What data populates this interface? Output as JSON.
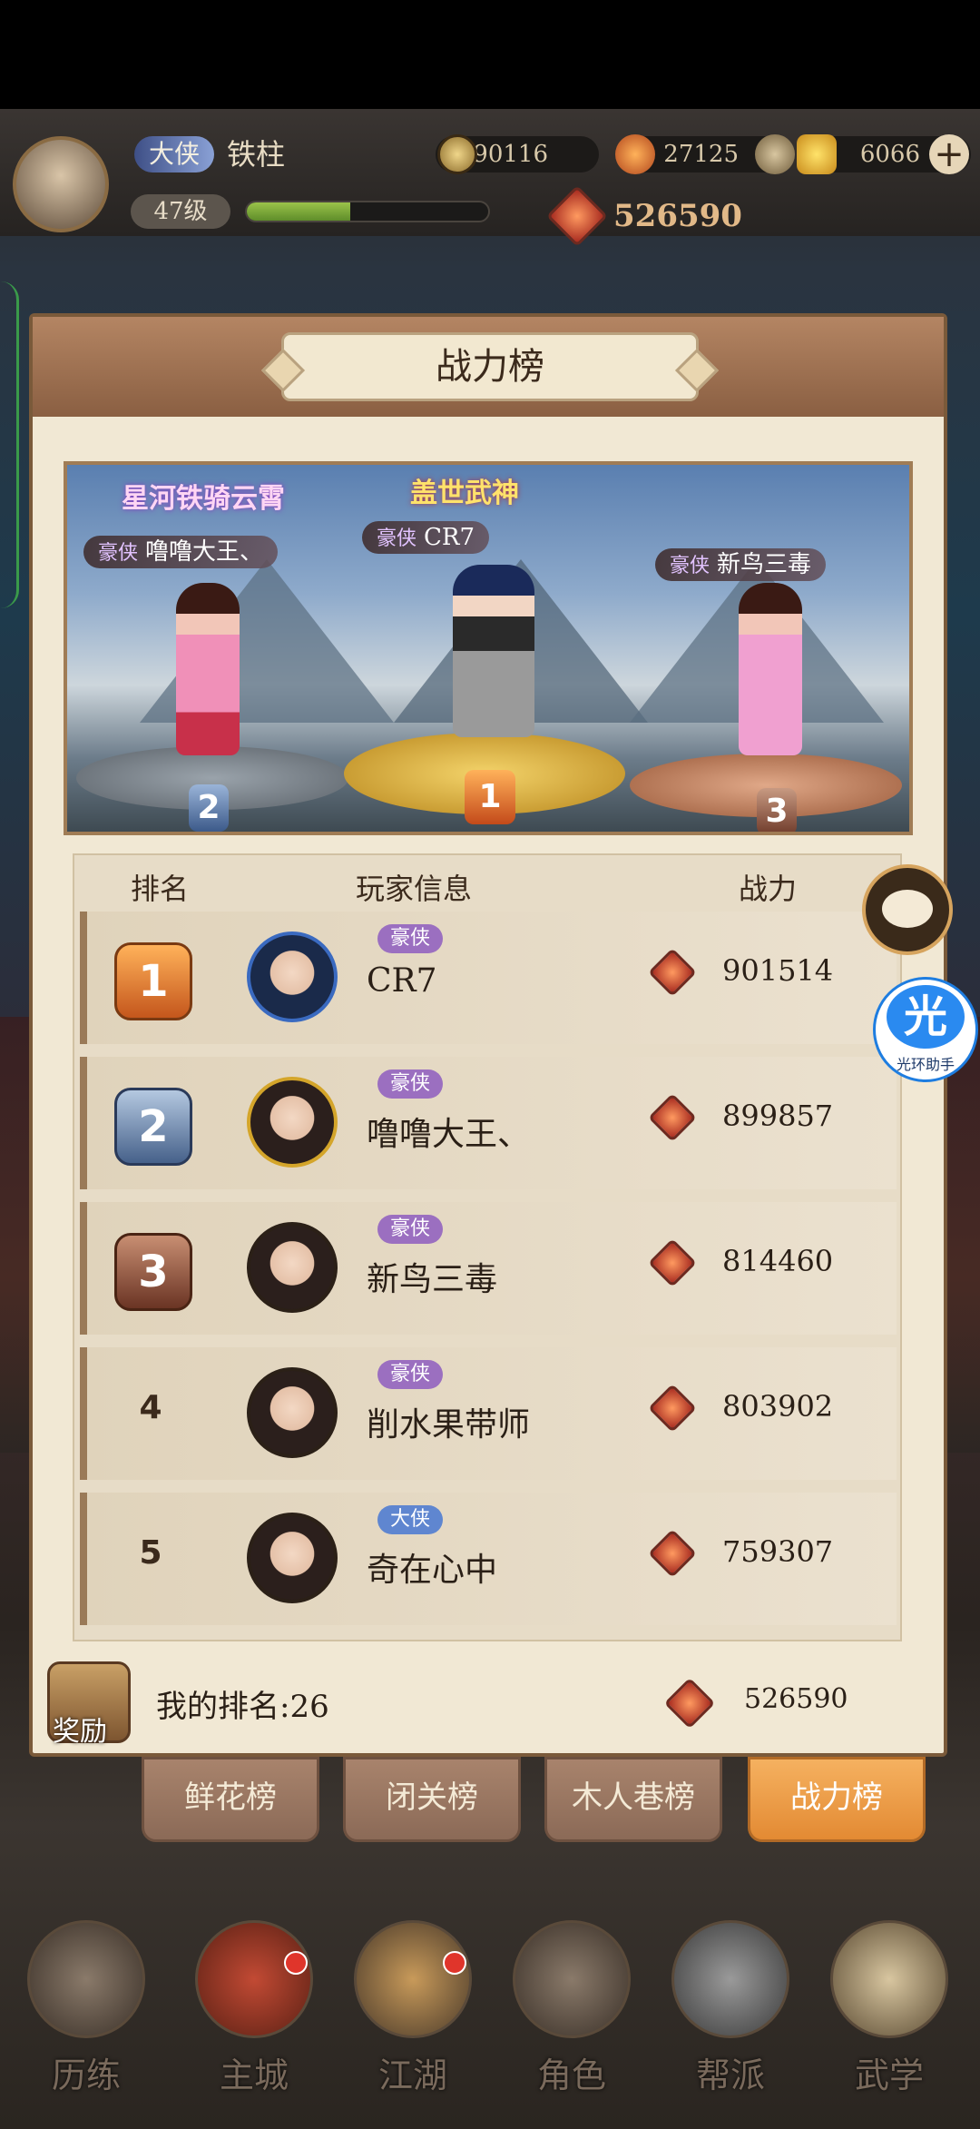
{
  "header": {
    "title_badge": "大侠",
    "player_name": "铁柱",
    "level": "47级",
    "xp_fraction": 0.43,
    "coins": "390116",
    "copper": "27125",
    "gold": "6066",
    "power": "526590"
  },
  "panel": {
    "title": "战力榜"
  },
  "podium": {
    "first": {
      "banner": "盖世武神",
      "tag": "豪侠",
      "name": "CR7",
      "rank": "1"
    },
    "second": {
      "banner": "星河铁骑云霄",
      "tag": "豪侠",
      "name": "噜噜大王、",
      "rank": "2"
    },
    "third": {
      "tag": "豪侠",
      "name": "新鸟三毒",
      "rank": "3"
    }
  },
  "table": {
    "headers": {
      "rank": "排名",
      "info": "玩家信息",
      "power": "战力"
    },
    "rows": [
      {
        "rank": "1",
        "tag": "豪侠",
        "name": "CR7",
        "power": "901514"
      },
      {
        "rank": "2",
        "tag": "豪侠",
        "name": "噜噜大王、",
        "power": "899857"
      },
      {
        "rank": "3",
        "tag": "豪侠",
        "name": "新鸟三毒",
        "power": "814460"
      },
      {
        "rank": "4",
        "tag": "豪侠",
        "name": "削水果带师",
        "power": "803902"
      },
      {
        "rank": "5",
        "tag": "大侠",
        "name": "奇在心中",
        "power": "759307"
      }
    ]
  },
  "my_rank": {
    "reward_label": "奖励",
    "label": "我的排名:26",
    "power": "526590"
  },
  "tabs": [
    {
      "label": "鲜花榜",
      "active": false
    },
    {
      "label": "闭关榜",
      "active": false
    },
    {
      "label": "木人巷榜",
      "active": false
    },
    {
      "label": "战力榜",
      "active": true
    }
  ],
  "nav": [
    {
      "label": "历练"
    },
    {
      "label": "主城"
    },
    {
      "label": "江湖"
    },
    {
      "label": "角色"
    },
    {
      "label": "帮派"
    },
    {
      "label": "武学"
    }
  ],
  "helper": {
    "glyph": "光",
    "label": "光环助手"
  },
  "colors": {
    "tag_haoxia": "#9b6fc0",
    "tag_daxia": "#5f86d0",
    "gold": "#d89a3a",
    "silver": "#8fa3bd",
    "bronze": "#a86a4a"
  }
}
